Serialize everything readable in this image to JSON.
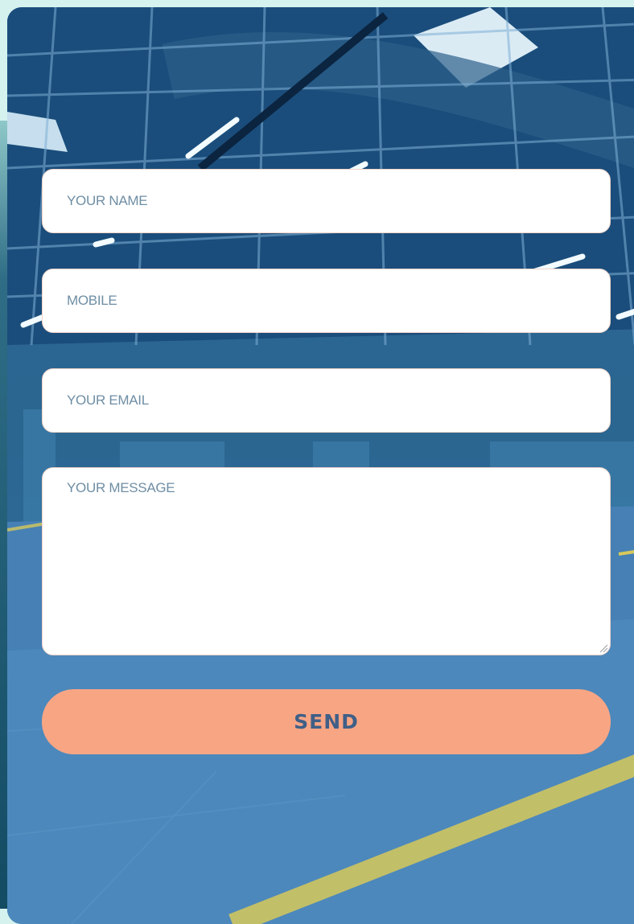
{
  "form": {
    "name_placeholder": "YOUR NAME",
    "mobile_placeholder": "MOBILE",
    "email_placeholder": "YOUR EMAIL",
    "message_placeholder": "YOUR MESSAGE",
    "send_label": "SEND"
  },
  "colors": {
    "page_bg": "#d5f2ee",
    "button_bg": "#f8a584",
    "button_text": "#3f5f87",
    "placeholder_text": "#6f8ea4",
    "field_bg": "#ffffff"
  },
  "icons": [
    "resize-handle-icon"
  ]
}
